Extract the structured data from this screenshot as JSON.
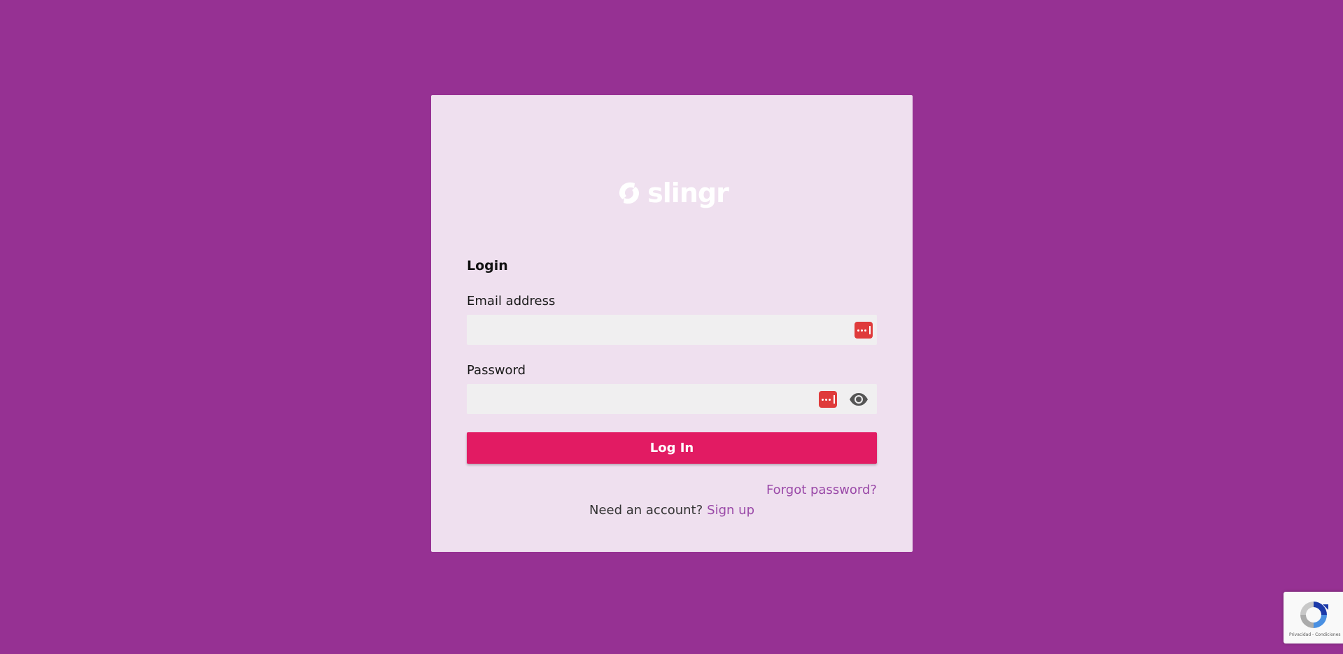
{
  "brand": {
    "name": "slingr",
    "logo_icon": "slingr-swirl-icon"
  },
  "form": {
    "heading": "Login",
    "email": {
      "label": "Email address",
      "value": "",
      "placeholder": ""
    },
    "password": {
      "label": "Password",
      "value": "",
      "placeholder": ""
    },
    "submit_label": "Log In",
    "forgot_label": "Forgot password?",
    "signup_prompt": "Need an account?",
    "signup_label": "Sign up"
  },
  "recaptcha": {
    "links": "Privacidad - Condiciones"
  },
  "colors": {
    "background": "#963193",
    "card": "#efe0ef",
    "primary_button": "#e21b63",
    "link": "#9a49a8",
    "password_manager": "#df3b3b"
  }
}
